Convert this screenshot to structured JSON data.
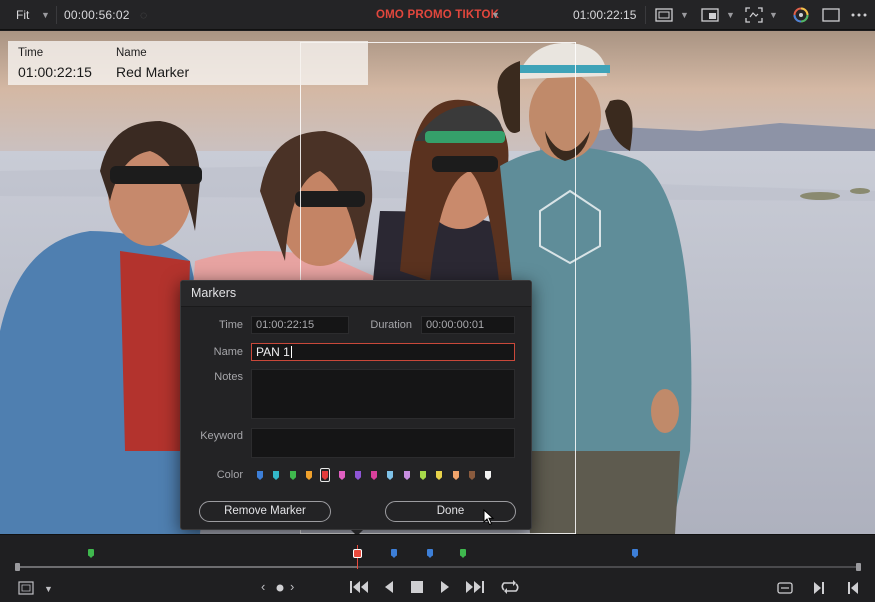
{
  "topbar": {
    "zoom_label": "Fit",
    "source_timecode": "00:00:56:02",
    "timeline_title": "OMO PROMO TIKTOK",
    "record_timecode": "01:00:22:15",
    "chevron": "v",
    "icons": [
      "viewer-layout-icon",
      "hd-overlay-icon",
      "transform-icon",
      "color-wheel-icon",
      "single-viewer-icon",
      "more-options-icon"
    ]
  },
  "overlay": {
    "time_label": "Time",
    "name_label": "Name",
    "time_value": "01:00:22:15",
    "name_value": "Red Marker"
  },
  "dialog": {
    "title": "Markers",
    "time_label": "Time",
    "time_value": "01:00:22:15",
    "duration_label": "Duration",
    "duration_value": "00:00:00:01",
    "name_label": "Name",
    "name_value": "PAN 1",
    "notes_label": "Notes",
    "notes_value": "",
    "keyword_label": "Keyword",
    "keyword_value": "",
    "color_label": "Color",
    "selected_color_index": 4,
    "colors": [
      "#3d7fd8",
      "#33b7c9",
      "#3fb84e",
      "#f0a12c",
      "#e33b3b",
      "#e05fc1",
      "#8f55d6",
      "#d9409b",
      "#7fc2e8",
      "#c88ee0",
      "#a8d94a",
      "#e8d24a",
      "#f0a36a",
      "#8a5b3e",
      "#f2f2f2"
    ],
    "remove_button": "Remove Marker",
    "done_button": "Done"
  },
  "timeline": {
    "markers": [
      {
        "color": "#3fb84e",
        "position": 0.087
      },
      {
        "color": "#e33b3b",
        "position": 0.405
      },
      {
        "color": "#3d7fd8",
        "position": 0.448
      },
      {
        "color": "#3d7fd8",
        "position": 0.49
      },
      {
        "color": "#3fb84e",
        "position": 0.53
      },
      {
        "color": "#3d7fd8",
        "position": 0.735
      }
    ],
    "playhead_position": 0.405,
    "nav_prev": "‹",
    "nav_next": "›"
  }
}
